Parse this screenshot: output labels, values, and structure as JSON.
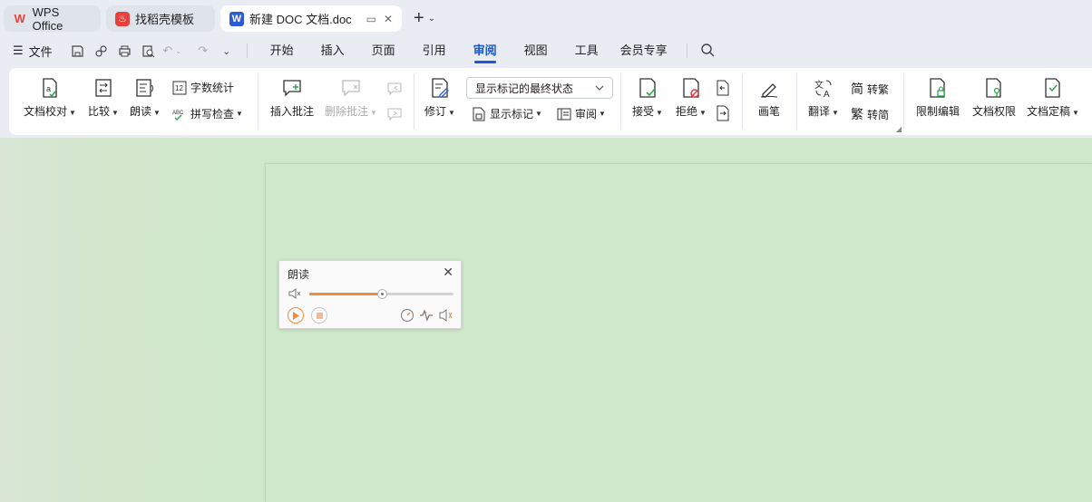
{
  "tabs": [
    {
      "label": "WPS Office",
      "icon": "wps-logo-icon"
    },
    {
      "label": "找稻壳模板",
      "icon": "docer-icon"
    },
    {
      "label": "新建 DOC 文档.doc",
      "icon": "word-doc-icon"
    }
  ],
  "menu": {
    "file_label": "文件",
    "tabs": [
      "开始",
      "插入",
      "页面",
      "引用",
      "审阅",
      "视图",
      "工具",
      "会员专享"
    ],
    "active_tab": "审阅"
  },
  "ribbon": {
    "proofread": "文档校对",
    "compare": "比较",
    "read_aloud": "朗读",
    "word_count": "字数统计",
    "spell_check": "拼写检查",
    "insert_comment": "插入批注",
    "delete_comment": "删除批注",
    "revise": "修订",
    "show_mode": "显示标记的最终状态",
    "show_markup": "显示标记",
    "review": "审阅",
    "accept": "接受",
    "reject": "拒绝",
    "pen": "画笔",
    "translate": "翻译",
    "to_traditional": "转繁",
    "to_simplified": "转简",
    "restrict_edit": "限制编辑",
    "doc_permission": "文档权限",
    "finalize": "文档定稿"
  },
  "read_panel": {
    "title": "朗读",
    "volume": 0.5
  },
  "colors": {
    "accent": "#1a57d6",
    "wps_red": "#e8413d",
    "doc_bg": "#cfe8cc",
    "slider": "#f08a3e"
  }
}
